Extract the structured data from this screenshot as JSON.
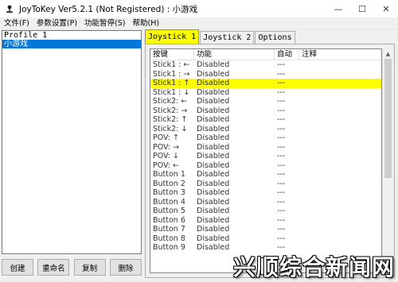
{
  "window": {
    "title": "JoyToKey Ver5.2.1 (Not Registered) : 小游戏",
    "icon": "joystick-icon",
    "controls": {
      "minimize": "—",
      "maximize": "☐",
      "close": "✕"
    }
  },
  "menu": [
    "文件(F)",
    "参数设置(P)",
    "功能暂停(S)",
    "帮助(H)"
  ],
  "profiles": {
    "items": [
      {
        "label": "Profile 1",
        "selected": false
      },
      {
        "label": "小游戏",
        "selected": true
      }
    ],
    "buttons": [
      "创建",
      "重命名",
      "复制",
      "删除"
    ]
  },
  "tabs": [
    {
      "label": "Joystick 1",
      "active": true
    },
    {
      "label": "Joystick 2",
      "active": false
    },
    {
      "label": "Options",
      "active": false
    }
  ],
  "grid": {
    "headers": [
      "按键",
      "功能",
      "自动",
      "注释"
    ],
    "rows": [
      {
        "key": "Stick1 : ←",
        "func": "Disabled",
        "auto": "---",
        "note": "",
        "highlight": false
      },
      {
        "key": "Stick1 : →",
        "func": "Disabled",
        "auto": "---",
        "note": "",
        "highlight": false
      },
      {
        "key": "Stick1 : ↑",
        "func": "Disabled",
        "auto": "---",
        "note": "",
        "highlight": true
      },
      {
        "key": "Stick1 : ↓",
        "func": "Disabled",
        "auto": "---",
        "note": "",
        "highlight": false
      },
      {
        "key": "Stick2: ←",
        "func": "Disabled",
        "auto": "---",
        "note": "",
        "highlight": false
      },
      {
        "key": "Stick2: →",
        "func": "Disabled",
        "auto": "---",
        "note": "",
        "highlight": false
      },
      {
        "key": "Stick2: ↑",
        "func": "Disabled",
        "auto": "---",
        "note": "",
        "highlight": false
      },
      {
        "key": "Stick2: ↓",
        "func": "Disabled",
        "auto": "---",
        "note": "",
        "highlight": false
      },
      {
        "key": "POV: ↑",
        "func": "Disabled",
        "auto": "---",
        "note": "",
        "highlight": false
      },
      {
        "key": "POV: →",
        "func": "Disabled",
        "auto": "---",
        "note": "",
        "highlight": false
      },
      {
        "key": "POV: ↓",
        "func": "Disabled",
        "auto": "---",
        "note": "",
        "highlight": false
      },
      {
        "key": "POV: ←",
        "func": "Disabled",
        "auto": "---",
        "note": "",
        "highlight": false
      },
      {
        "key": "Button 1",
        "func": "Disabled",
        "auto": "---",
        "note": "",
        "highlight": false
      },
      {
        "key": "Button 2",
        "func": "Disabled",
        "auto": "---",
        "note": "",
        "highlight": false
      },
      {
        "key": "Button 3",
        "func": "Disabled",
        "auto": "---",
        "note": "",
        "highlight": false
      },
      {
        "key": "Button 4",
        "func": "Disabled",
        "auto": "---",
        "note": "",
        "highlight": false
      },
      {
        "key": "Button 5",
        "func": "Disabled",
        "auto": "---",
        "note": "",
        "highlight": false
      },
      {
        "key": "Button 6",
        "func": "Disabled",
        "auto": "---",
        "note": "",
        "highlight": false
      },
      {
        "key": "Button 7",
        "func": "Disabled",
        "auto": "---",
        "note": "",
        "highlight": false
      },
      {
        "key": "Button 8",
        "func": "Disabled",
        "auto": "---",
        "note": "",
        "highlight": false
      },
      {
        "key": "Button 9",
        "func": "Disabled",
        "auto": "---",
        "note": "",
        "highlight": false
      }
    ]
  },
  "colors": {
    "highlight": "#ffff00",
    "selection": "#0078d7",
    "active_tab": "#ffff00"
  },
  "watermark": "兴顺综合新闻网"
}
